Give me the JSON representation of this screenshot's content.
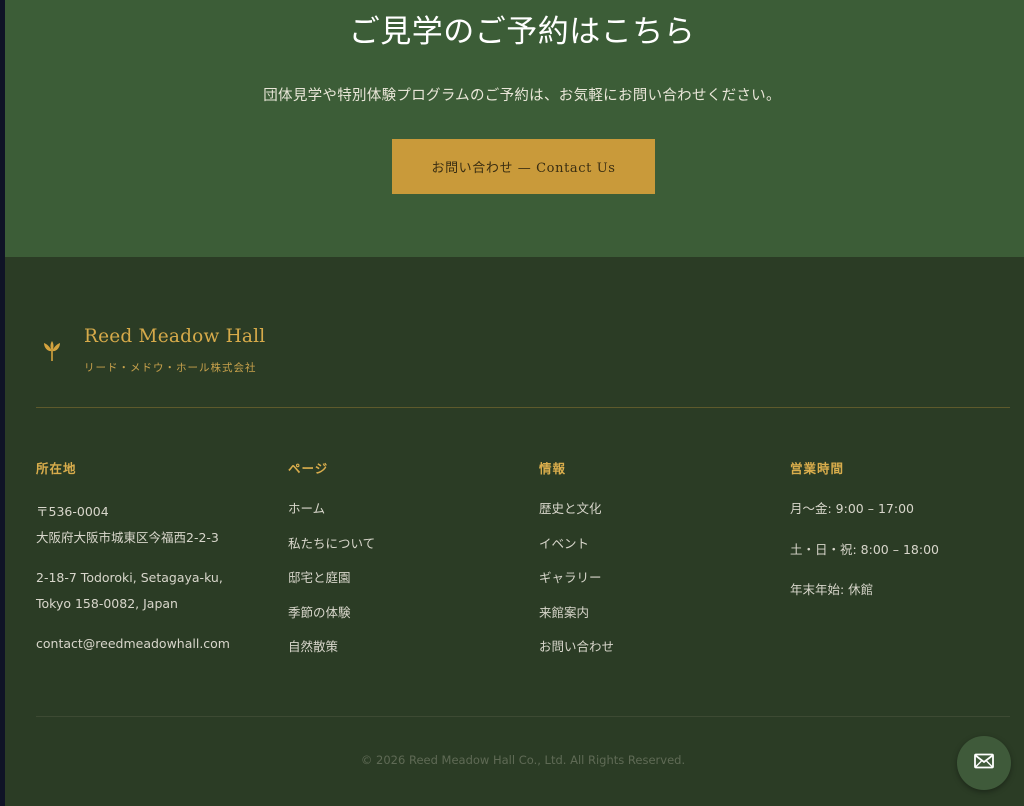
{
  "cta": {
    "title": "ご見学のご予約はこちら",
    "subtitle": "団体見学や特別体験プログラムのご予約は、お気軽にお問い合わせください。",
    "button_label": "お問い合わせ — Contact Us"
  },
  "brand": {
    "name": "Reed Meadow Hall",
    "company": "リード・メドウ・ホール株式会社",
    "icon": "flower-icon"
  },
  "footer": {
    "address": {
      "title": "所在地",
      "postal": "〒536-0004",
      "jp_address": "大阪府大阪市城東区今福西2-2-3",
      "en_line1": "2-18-7 Todoroki, Setagaya-ku,",
      "en_line2": "Tokyo 158-0082, Japan",
      "email": "contact@reedmeadowhall.com"
    },
    "pages": {
      "title": "ページ",
      "items": [
        "ホーム",
        "私たちについて",
        "邸宅と庭園",
        "季節の体験",
        "自然散策"
      ]
    },
    "info": {
      "title": "情報",
      "items": [
        "歴史と文化",
        "イベント",
        "ギャラリー",
        "来館案内",
        "お問い合わせ"
      ]
    },
    "hours": {
      "title": "営業時間",
      "weekdays": "月〜金: 9:00 – 17:00",
      "weekend": "土・日・祝: 8:00 – 18:00",
      "holiday": "年末年始: 休館"
    },
    "copyright": "© 2026 Reed Meadow Hall Co., Ltd. All Rights Reserved."
  },
  "fab": {
    "icon": "mail-icon"
  },
  "colors": {
    "cta_bg": "#3c5d37",
    "footer_bg": "#2b3c25",
    "accent_gold": "#c99a3a"
  }
}
